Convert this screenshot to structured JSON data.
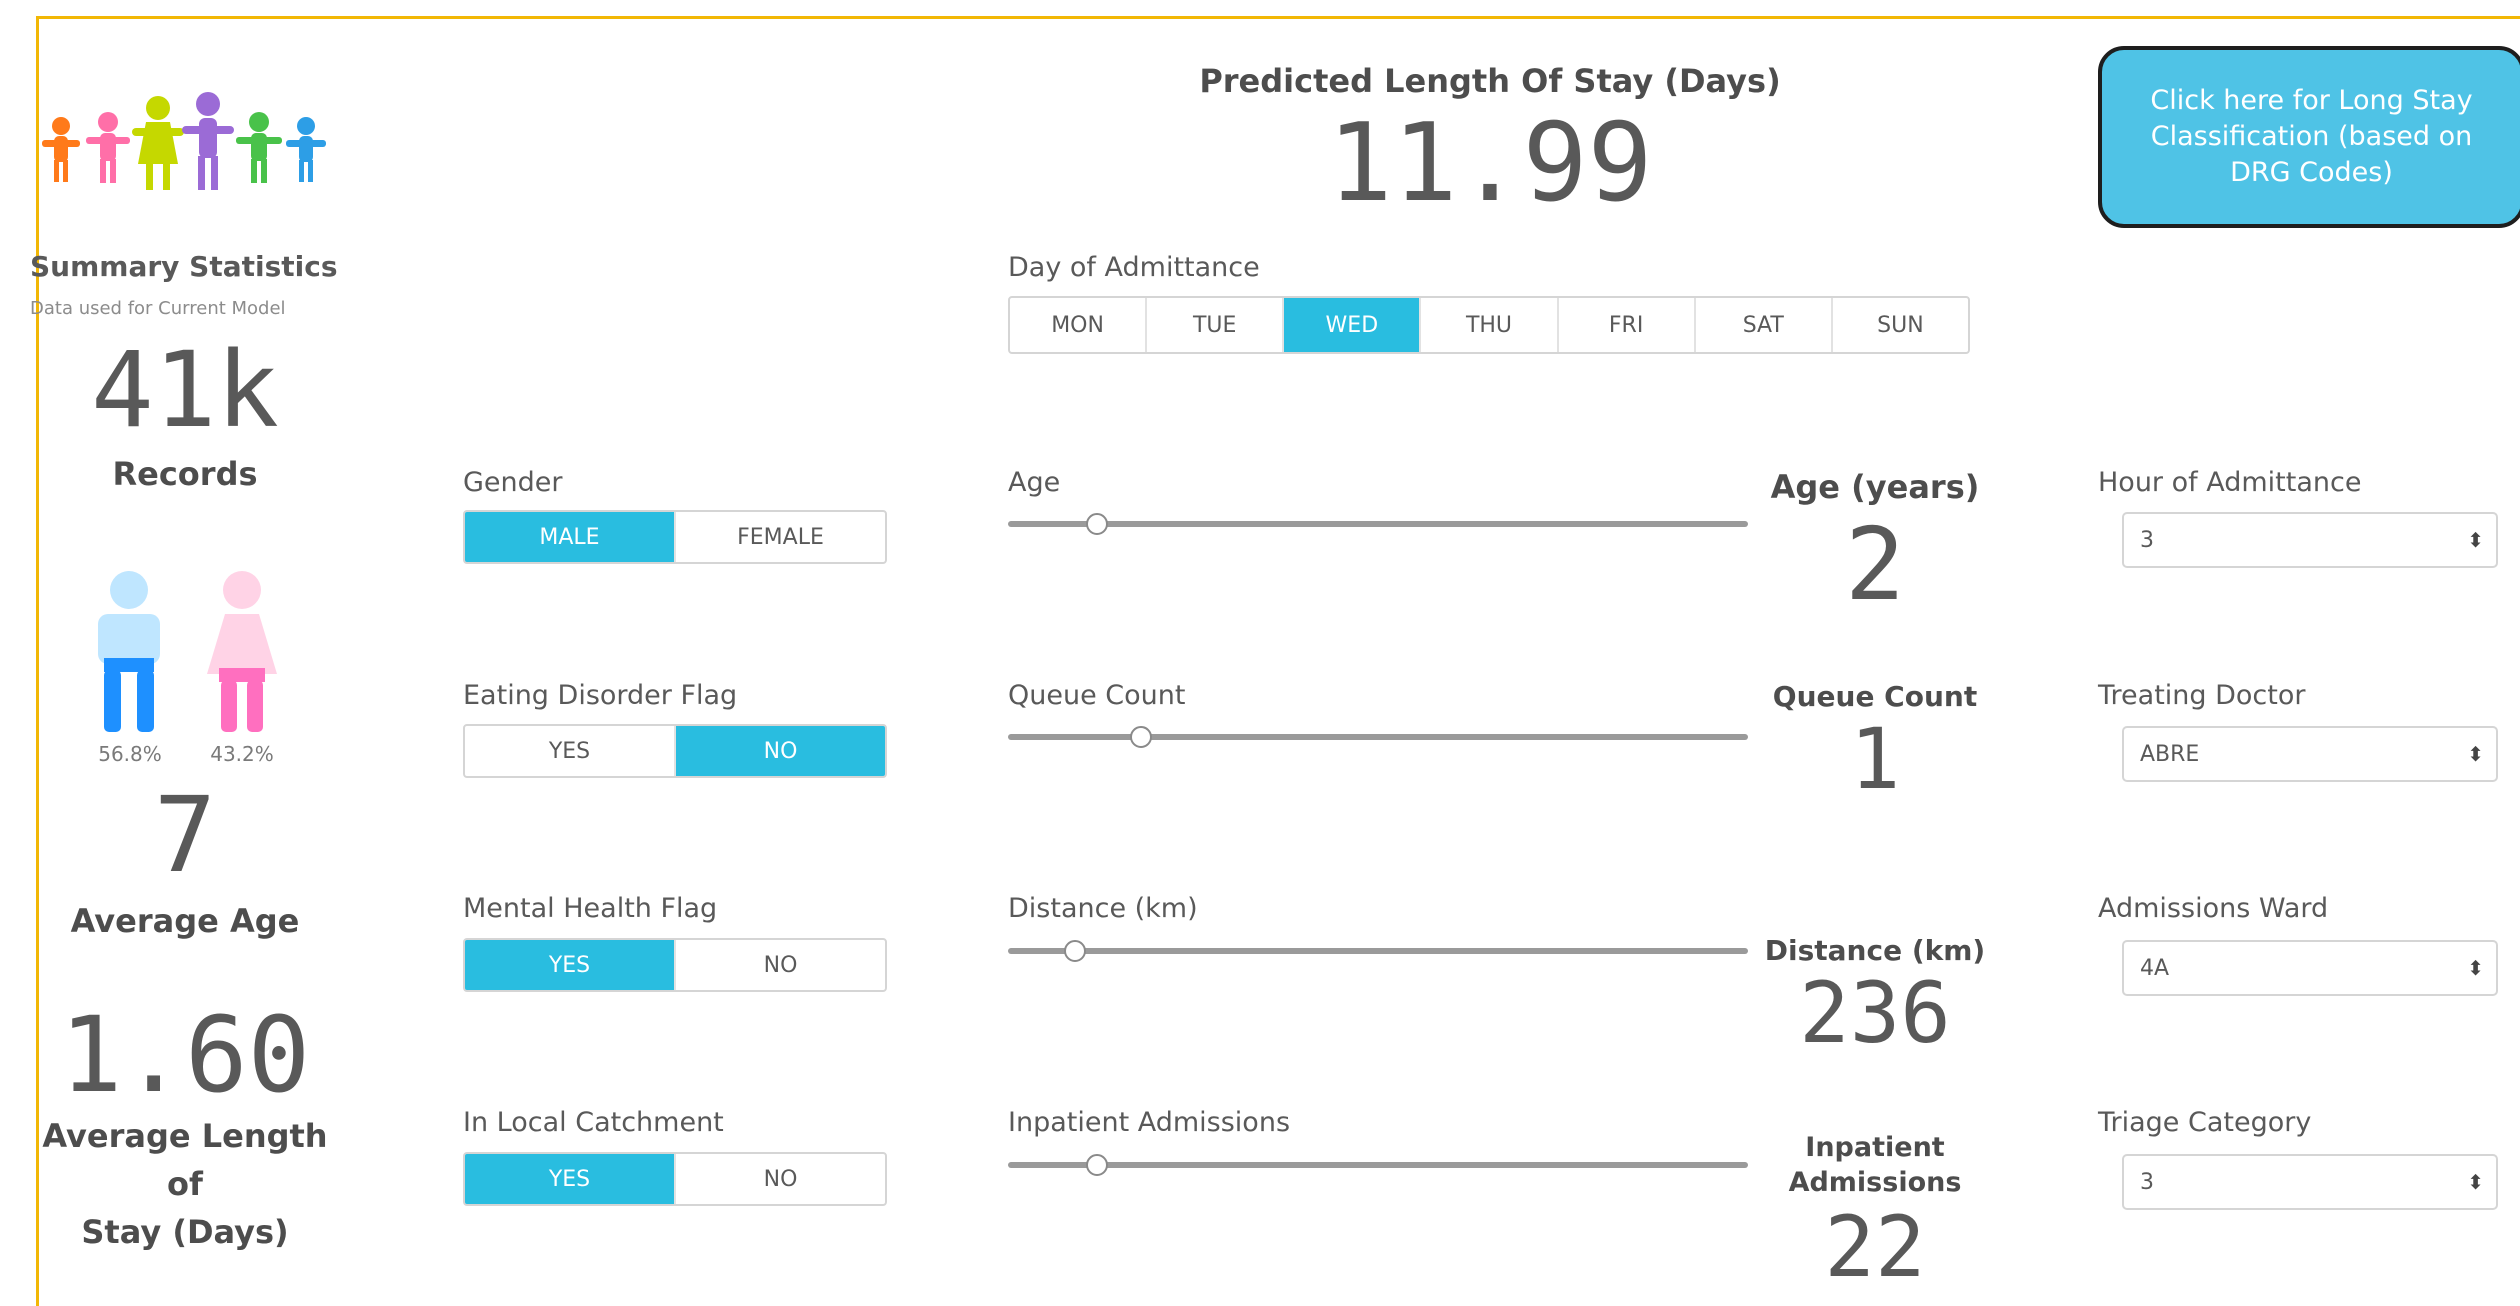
{
  "header": {
    "predicted_label": "Predicted Length Of Stay (Days)",
    "predicted_value": "11.99",
    "long_stay_button": "Click here for Long Stay Classification (based on DRG Codes)"
  },
  "summary": {
    "title": "Summary Statistics",
    "subtitle": "Data used for Current Model",
    "records_value": "41k",
    "records_label": "Records",
    "male_pct": "56.8%",
    "female_pct": "43.2%",
    "avg_age_value": "7",
    "avg_age_label": "Average Age",
    "avg_stay_value": "1.60",
    "avg_stay_label_line1": "Average Length of",
    "avg_stay_label_line2": "Stay (Days)"
  },
  "day_of_admittance": {
    "label": "Day of Admittance",
    "options": [
      "MON",
      "TUE",
      "WED",
      "THU",
      "FRI",
      "SAT",
      "SUN"
    ],
    "selected": "WED"
  },
  "gender": {
    "label": "Gender",
    "options": [
      "MALE",
      "FEMALE"
    ],
    "selected": "MALE"
  },
  "eating_disorder": {
    "label": "Eating Disorder Flag",
    "options": [
      "YES",
      "NO"
    ],
    "selected": "NO"
  },
  "mental_health": {
    "label": "Mental Health Flag",
    "options": [
      "YES",
      "NO"
    ],
    "selected": "YES"
  },
  "local_catchment": {
    "label": "In Local Catchment",
    "options": [
      "YES",
      "NO"
    ],
    "selected": "YES"
  },
  "sliders": {
    "age": {
      "label": "Age",
      "level": 0.12
    },
    "queue_count": {
      "label": "Queue Count",
      "level": 0.18
    },
    "distance": {
      "label": "Distance (km)",
      "level": 0.09
    },
    "inpatient": {
      "label": "Inpatient Admissions",
      "level": 0.12
    }
  },
  "readouts": {
    "age_label": "Age (years)",
    "age_value": "2",
    "queue_label": "Queue Count",
    "queue_value": "1",
    "distance_label": "Distance (km)",
    "distance_value": "236",
    "inpatient_label_line1": "Inpatient",
    "inpatient_label_line2": "Admissions",
    "inpatient_value": "22"
  },
  "dropdowns": {
    "hour": {
      "label": "Hour of Admittance",
      "value": "3"
    },
    "doctor": {
      "label": "Treating Doctor",
      "value": "ABRE"
    },
    "ward": {
      "label": "Admissions Ward",
      "value": "4A"
    },
    "triage": {
      "label": "Triage Category",
      "value": "3"
    }
  },
  "colors": {
    "accent": "#29bde0",
    "frame": "#f2b705",
    "button": "#4fc3e6",
    "male": "#1e90ff",
    "female": "#ff8fbf"
  }
}
